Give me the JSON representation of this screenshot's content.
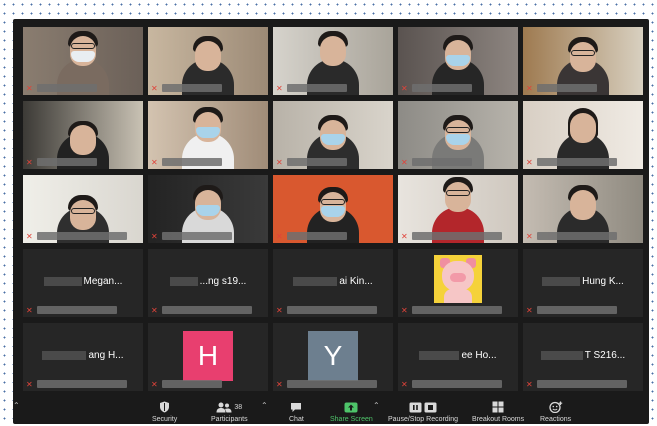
{
  "toolbar": {
    "security": "Security",
    "participants": "Participants",
    "participants_count": "38",
    "chat": "Chat",
    "share_screen": "Share Screen",
    "recording": "Pause/Stop Recording",
    "breakout": "Breakout Rooms",
    "reactions": "Reactions"
  },
  "tiles": {
    "r4c1": "Megan...",
    "r4c2": "...ng s19...",
    "r4c3": "ai Kin...",
    "r4c5": "Hung K...",
    "r5c1": "ang H...",
    "r5c2": "H",
    "r5c3": "Y",
    "r5c4": "ee Ho...",
    "r5c5": "T S216..."
  },
  "colors": {
    "avatar_h": "#e83f6f",
    "avatar_y": "#6d7f8f",
    "share_green": "#4ec46a",
    "mic_off_red": "#e0433a"
  }
}
